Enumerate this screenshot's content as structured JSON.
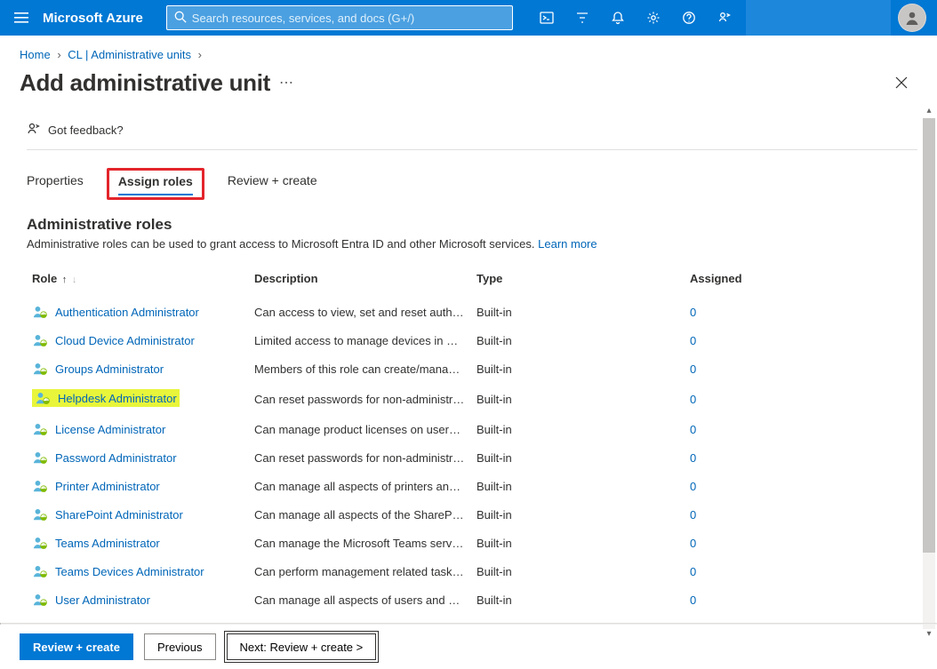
{
  "topbar": {
    "brand": "Microsoft Azure",
    "search_placeholder": "Search resources, services, and docs (G+/)"
  },
  "breadcrumb": {
    "home": "Home",
    "parent": "CL | Administrative units"
  },
  "page": {
    "title": "Add administrative unit",
    "feedback": "Got feedback?"
  },
  "tabs": {
    "properties": "Properties",
    "assign_roles": "Assign roles",
    "review_create": "Review + create"
  },
  "section": {
    "title": "Administrative roles",
    "subtitle_prefix": "Administrative roles can be used to grant access to Microsoft Entra ID and other Microsoft services. ",
    "learn_more": "Learn more"
  },
  "columns": {
    "role": "Role",
    "description": "Description",
    "type": "Type",
    "assigned": "Assigned"
  },
  "roles": [
    {
      "name": "Authentication Administrator",
      "description": "Can access to view, set and reset authe…",
      "type": "Built-in",
      "assigned": "0",
      "highlighted": false
    },
    {
      "name": "Cloud Device Administrator",
      "description": "Limited access to manage devices in Mi…",
      "type": "Built-in",
      "assigned": "0",
      "highlighted": false
    },
    {
      "name": "Groups Administrator",
      "description": "Members of this role can create/manag…",
      "type": "Built-in",
      "assigned": "0",
      "highlighted": false
    },
    {
      "name": "Helpdesk Administrator",
      "description": "Can reset passwords for non-administra…",
      "type": "Built-in",
      "assigned": "0",
      "highlighted": true
    },
    {
      "name": "License Administrator",
      "description": "Can manage product licenses on users …",
      "type": "Built-in",
      "assigned": "0",
      "highlighted": false
    },
    {
      "name": "Password Administrator",
      "description": "Can reset passwords for non-administra…",
      "type": "Built-in",
      "assigned": "0",
      "highlighted": false
    },
    {
      "name": "Printer Administrator",
      "description": "Can manage all aspects of printers and …",
      "type": "Built-in",
      "assigned": "0",
      "highlighted": false
    },
    {
      "name": "SharePoint Administrator",
      "description": "Can manage all aspects of the SharePoi…",
      "type": "Built-in",
      "assigned": "0",
      "highlighted": false
    },
    {
      "name": "Teams Administrator",
      "description": "Can manage the Microsoft Teams service.",
      "type": "Built-in",
      "assigned": "0",
      "highlighted": false
    },
    {
      "name": "Teams Devices Administrator",
      "description": "Can perform management related tasks…",
      "type": "Built-in",
      "assigned": "0",
      "highlighted": false
    },
    {
      "name": "User Administrator",
      "description": "Can manage all aspects of users and gr…",
      "type": "Built-in",
      "assigned": "0",
      "highlighted": false
    }
  ],
  "footer": {
    "review_create": "Review + create",
    "previous": "Previous",
    "next": "Next: Review + create >"
  }
}
